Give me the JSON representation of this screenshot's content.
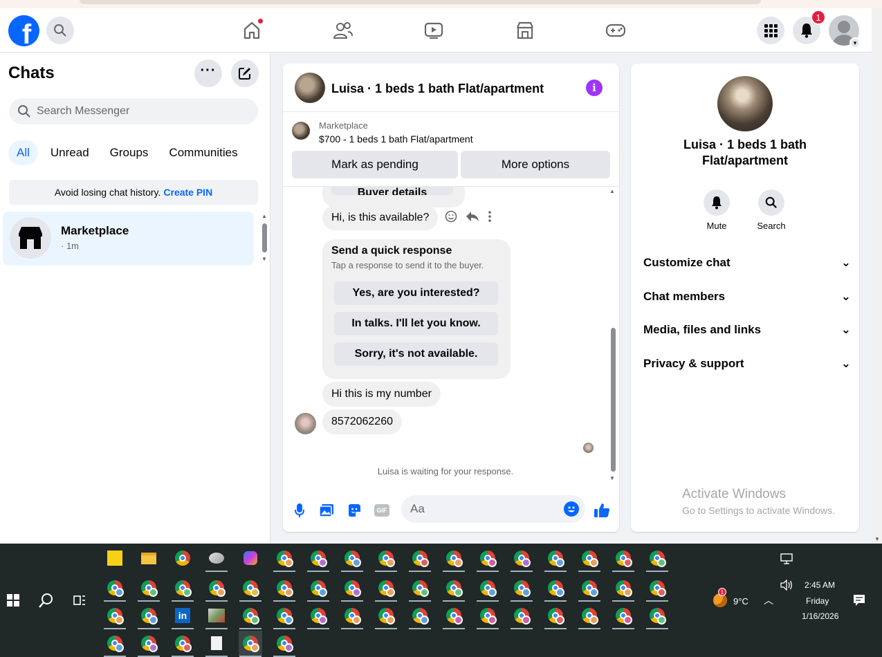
{
  "header": {
    "logo_letter": "f",
    "notification_count": "1",
    "nav": [
      "home-icon",
      "friends-icon",
      "video-icon",
      "marketplace-icon",
      "gaming-icon"
    ]
  },
  "chats": {
    "title": "Chats",
    "search_placeholder": "Search Messenger",
    "filters": [
      "All",
      "Unread",
      "Groups",
      "Communities"
    ],
    "pin_banner_text": "Avoid losing chat history.",
    "pin_banner_link": "Create PIN",
    "list": [
      {
        "name": "Marketplace",
        "time": "· 1m"
      }
    ]
  },
  "conversation": {
    "title": "Luisa · 1 beds 1 bath Flat/apartment",
    "listing_source": "Marketplace",
    "listing_text": "$700 - 1 beds 1 bath Flat/apartment",
    "mark_pending_label": "Mark as pending",
    "more_options_label": "More options",
    "partial_button": "Buyer details",
    "messages": {
      "available": "Hi, is this available?",
      "quick_title": "Send a quick response",
      "quick_subtitle": "Tap a response to send it to the buyer.",
      "quick_options": [
        "Yes, are you interested?",
        "In talks. I'll let you know.",
        "Sorry, it's not available."
      ],
      "number_intro": "Hi this is my number",
      "number": "8572062260"
    },
    "waiting_text": "Luisa is waiting for your response.",
    "composer_placeholder": "Aa",
    "gif_label": "GIF"
  },
  "info_panel": {
    "name": "Luisa · 1 beds 1 bath Flat/apartment",
    "mute_label": "Mute",
    "search_label": "Search",
    "sections": [
      "Customize chat",
      "Chat members",
      "Media, files and links",
      "Privacy & support"
    ]
  },
  "watermark": {
    "title": "Activate Windows",
    "subtitle": "Go to Settings to activate Windows."
  },
  "taskbar": {
    "weather_temp": "9°C",
    "weather_badge": "1",
    "time": "2:45 AM",
    "day": "Friday",
    "date": "1/16/2026",
    "linkedin_label": "in"
  },
  "colors": {
    "brand": "#0866ff",
    "info": "#a033ff",
    "alert": "#e41e3f",
    "taskbar": "#202828"
  }
}
